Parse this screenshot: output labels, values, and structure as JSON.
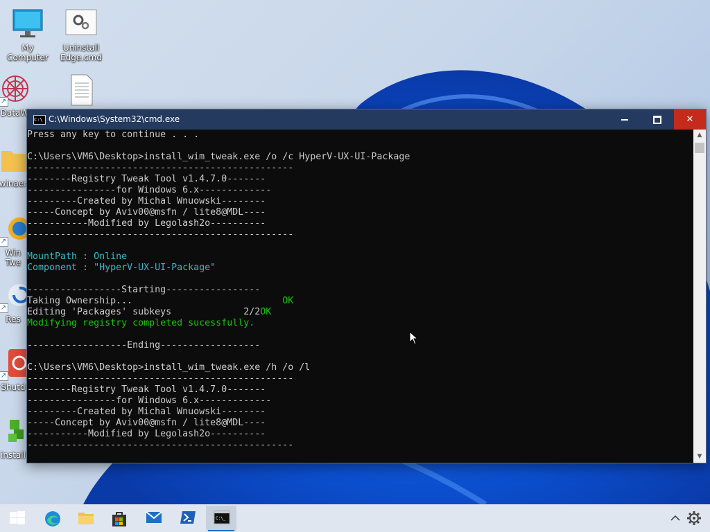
{
  "desktop": {
    "icons": [
      {
        "label": "My Computer"
      },
      {
        "label": "Uninstall Edge.cmd"
      },
      {
        "label": "DataW"
      },
      {
        "label": ""
      },
      {
        "label": "winaer"
      },
      {
        "label": "Win Twe"
      },
      {
        "label": "Res"
      },
      {
        "label": "Shutd"
      },
      {
        "label": "install"
      }
    ]
  },
  "cmd": {
    "title": "C:\\Windows\\System32\\cmd.exe",
    "lines": [
      {
        "text": "Press any key to continue . . .",
        "color": "gray"
      },
      {
        "text": "",
        "color": "gray"
      },
      {
        "text": "C:\\Users\\VM6\\Desktop>install_wim_tweak.exe /o /c HyperV-UX-UI-Package",
        "color": "gray"
      },
      {
        "text": "------------------------------------------------",
        "color": "gray"
      },
      {
        "text": "--------Registry Tweak Tool v1.4.7.0-------",
        "color": "gray"
      },
      {
        "text": "----------------for Windows 6.x-------------",
        "color": "gray"
      },
      {
        "text": "---------Created by Michal Wnuowski--------",
        "color": "gray"
      },
      {
        "text": "-----Concept by Aviv00@msfn / lite8@MDL----",
        "color": "gray"
      },
      {
        "text": "-----------Modified by Legolash2o----------",
        "color": "gray"
      },
      {
        "text": "------------------------------------------------",
        "color": "gray"
      },
      {
        "text": "",
        "color": "gray"
      },
      {
        "text": "MountPath : Online",
        "color": "cyan"
      },
      {
        "text": "Component : \"HyperV-UX-UI-Package\"",
        "color": "cyan"
      },
      {
        "text": "",
        "color": "gray"
      },
      {
        "text": "-----------------Starting-----------------",
        "color": "gray"
      },
      {
        "text": "Taking Ownership...",
        "color": "gray",
        "suffix": "OK",
        "pad": 46
      },
      {
        "text": "Editing 'Packages' subkeys             2/2",
        "color": "gray",
        "suffix": "OK",
        "pad": 0
      },
      {
        "text": "Modifying registry completed sucessfully.",
        "color": "green"
      },
      {
        "text": "",
        "color": "gray"
      },
      {
        "text": "------------------Ending------------------",
        "color": "gray"
      },
      {
        "text": "",
        "color": "gray"
      },
      {
        "text": "C:\\Users\\VM6\\Desktop>install_wim_tweak.exe /h /o /l",
        "color": "gray"
      },
      {
        "text": "------------------------------------------------",
        "color": "gray"
      },
      {
        "text": "--------Registry Tweak Tool v1.4.7.0-------",
        "color": "gray"
      },
      {
        "text": "----------------for Windows 6.x-------------",
        "color": "gray"
      },
      {
        "text": "---------Created by Michal Wnuowski--------",
        "color": "gray"
      },
      {
        "text": "-----Concept by Aviv00@msfn / lite8@MDL----",
        "color": "gray"
      },
      {
        "text": "-----------Modified by Legolash2o----------",
        "color": "gray"
      },
      {
        "text": "------------------------------------------------",
        "color": "gray"
      }
    ]
  },
  "taskbar": {
    "items": [
      {
        "name": "start-button",
        "icon": "windows-logo-icon"
      },
      {
        "name": "edge-button",
        "icon": "edge-icon"
      },
      {
        "name": "file-explorer-button",
        "icon": "folder-icon"
      },
      {
        "name": "store-button",
        "icon": "store-icon"
      },
      {
        "name": "mail-button",
        "icon": "mail-icon"
      },
      {
        "name": "powershell-button",
        "icon": "powershell-icon"
      },
      {
        "name": "cmd-button",
        "icon": "cmd-icon"
      }
    ]
  },
  "colors": {
    "console_bg": "#0c0c0c",
    "console_text": "#cccccc",
    "console_cyan": "#3ab7c8",
    "console_green": "#16c60c",
    "titlebar": "#243a5e",
    "close": "#c42b1c"
  }
}
